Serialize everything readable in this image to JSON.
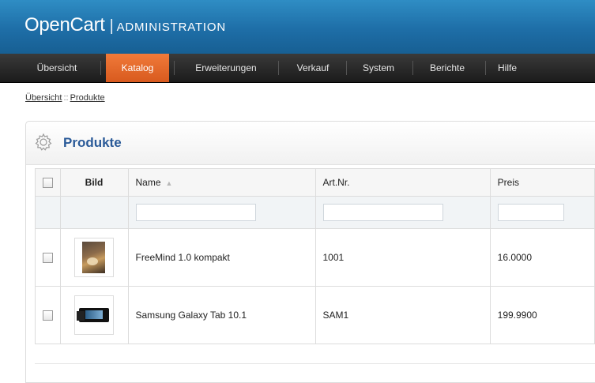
{
  "header": {
    "brand": "OpenCart",
    "separator": "|",
    "subtitle": "ADMINISTRATION"
  },
  "menu": {
    "items": [
      {
        "label": "Übersicht",
        "active": false
      },
      {
        "label": "Katalog",
        "active": true
      },
      {
        "label": "Erweiterungen",
        "active": false
      },
      {
        "label": "Verkauf",
        "active": false
      },
      {
        "label": "System",
        "active": false
      },
      {
        "label": "Berichte",
        "active": false
      },
      {
        "label": "Hilfe",
        "active": false
      }
    ]
  },
  "breadcrumb": {
    "home": "Übersicht",
    "separator": "::",
    "current": "Produkte"
  },
  "panel": {
    "title": "Produkte",
    "icon": "gear-icon"
  },
  "table": {
    "columns": {
      "image": "Bild",
      "name": "Name",
      "sku": "Art.Nr.",
      "price": "Preis"
    },
    "rows": [
      {
        "name": "FreeMind 1.0 kompakt",
        "sku": "1001",
        "price": "16.0000",
        "image": "book-thumbnail"
      },
      {
        "name": "Samsung Galaxy Tab 10.1",
        "sku": "SAM1",
        "price": "199.9900",
        "image": "tablet-thumbnail"
      }
    ]
  },
  "colors": {
    "header_blue": "#1e6ea7",
    "menu_dark": "#1b1b1b",
    "active_orange": "#e0652a",
    "title_blue": "#2a5a98"
  }
}
